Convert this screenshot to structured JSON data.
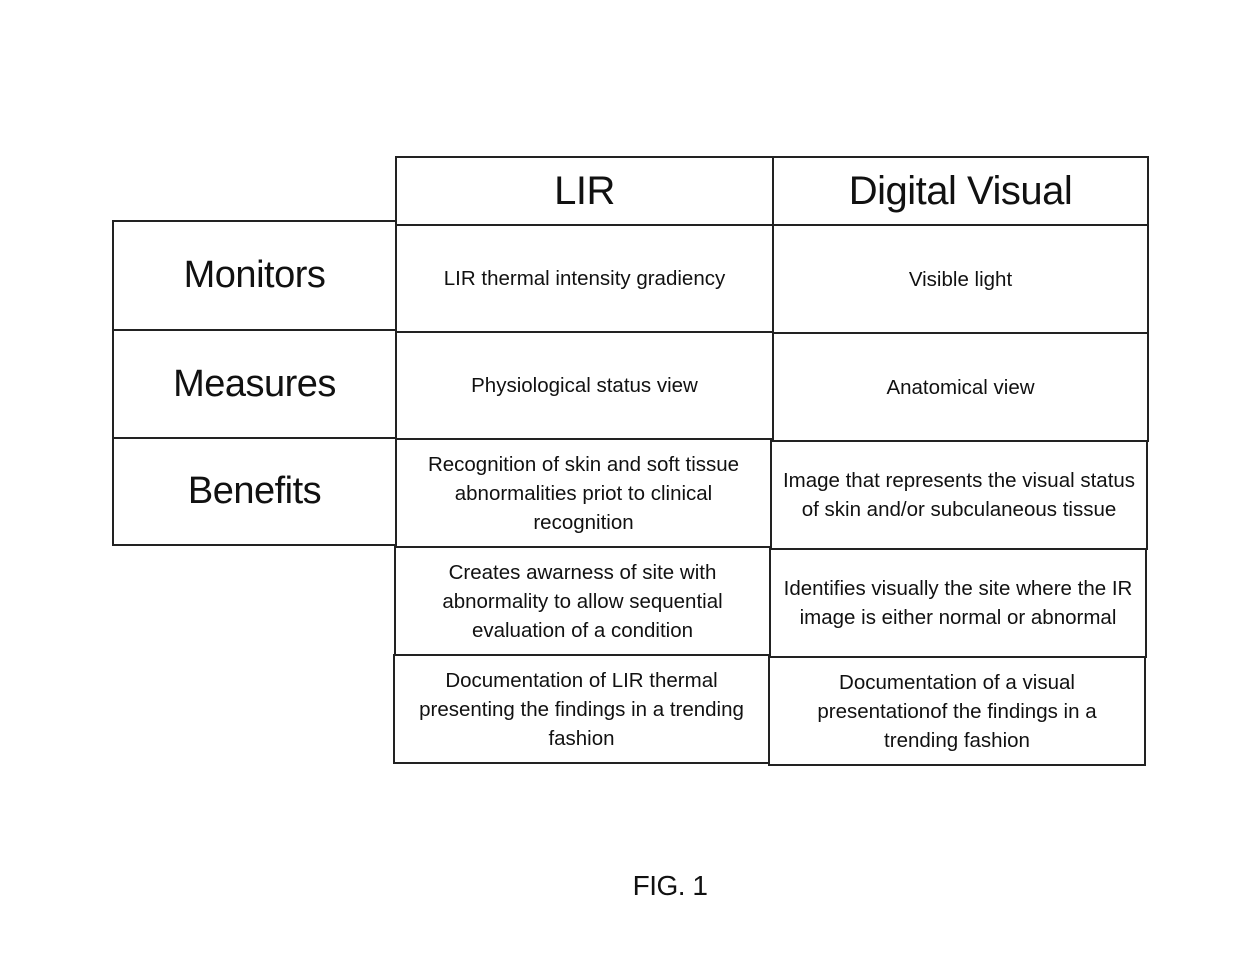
{
  "table": {
    "columns": [
      "LIR",
      "Digital Visual"
    ],
    "rows": [
      {
        "label": "Monitors",
        "cells": [
          "LIR thermal intensity gradiency",
          "Visible light"
        ]
      },
      {
        "label": "Measures",
        "cells": [
          "Physiological status view",
          "Anatomical view"
        ]
      },
      {
        "label": "Benefits",
        "cells": [
          "Recognition of skin and soft tissue abnormalities priot to clinical recognition",
          "Image that represents the visual status of skin and/or subculaneous tissue"
        ]
      },
      {
        "label": "",
        "cells": [
          "Creates awarness of site with abnormality to allow sequential evaluation of a condition",
          "Identifies visually the site where the IR image is either normal or abnormal"
        ]
      },
      {
        "label": "",
        "cells": [
          "Documentation of LIR thermal presenting the findings in a trending fashion",
          "Documentation of a visual presentationof the findings in a trending fashion"
        ]
      }
    ]
  },
  "figure_label": "FIG. 1"
}
